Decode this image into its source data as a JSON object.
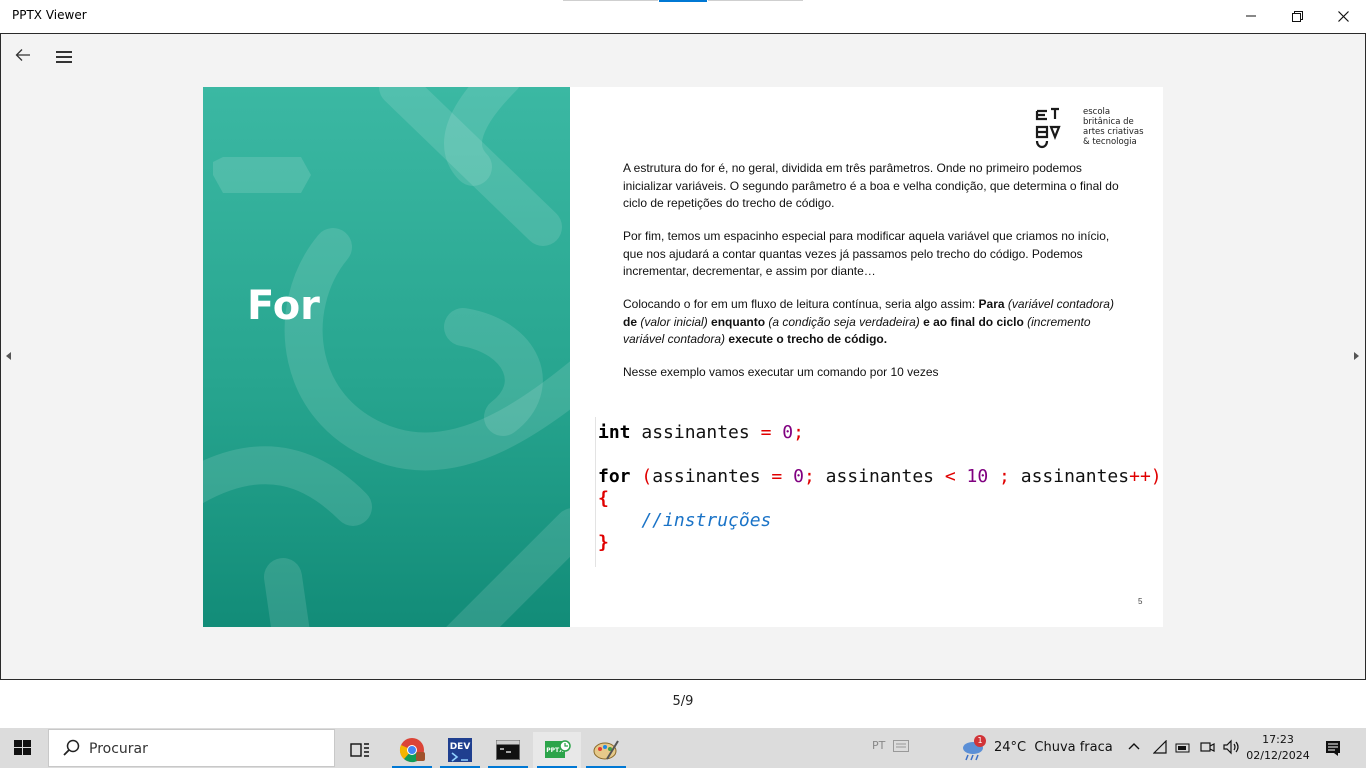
{
  "window": {
    "title": "PPTX Viewer",
    "minimize_icon": "minimize-icon",
    "restore_icon": "restore-icon",
    "close_icon": "close-icon"
  },
  "toolbar": {
    "back_icon": "arrow-left-icon",
    "menu_icon": "hamburger-menu-icon"
  },
  "slide": {
    "title": "For",
    "logo_text": [
      "escola",
      "britânica de",
      "artes criativas",
      "& tecnologia"
    ],
    "paragraph1": "A estrutura do for é, no geral, dividida em três parâmetros. Onde no primeiro podemos inicializar variáveis. O segundo parâmetro é a boa e velha condição, que determina o final do ciclo de repetições do trecho de código.",
    "paragraph2": "Por fim, temos um espacinho especial para modificar aquela variável que criamos no início, que nos ajudará a contar quantas vezes já passamos pelo trecho do código. Podemos incrementar, decrementar, e assim por diante…",
    "paragraph3": {
      "intro": "Colocando o for em um fluxo de leitura contínua, seria algo assim:  ",
      "para": "Para",
      "p1": " (variável contadora)",
      "de": "de",
      "p2": " (valor inicial) ",
      "enquanto": "enquanto",
      "p3": " (a condição seja verdadeira) ",
      "final": "e ao final do ciclo",
      "p4": " (incremento variável contadora) ",
      "execute": "execute o trecho de código."
    },
    "paragraph4": "Nesse exemplo vamos executar um comando por 10 vezes",
    "code": {
      "l1_kw": "int",
      "l1_id": " assinantes ",
      "l1_op": "=",
      "l1_num": " 0",
      "l1_end": ";",
      "l2_kw": "for",
      "l2_p1": " (",
      "l2_id1": "assinantes ",
      "l2_op1": "=",
      "l2_num1": " 0",
      "l2_semi1": ";",
      "l2_id2": " assinantes ",
      "l2_op2": "<",
      "l2_num2": " 10",
      "l2_semi2": " ;",
      "l2_id3": " assinantes",
      "l2_op3": "++",
      "l2_p2": ")",
      "l3": "{",
      "l4": "    //instruções",
      "l5": "}"
    },
    "page_number": "5"
  },
  "navigation": {
    "prev_icon": "chevron-left-icon",
    "next_icon": "chevron-right-icon",
    "counter": "5/9"
  },
  "taskbar": {
    "search_placeholder": "Procurar",
    "language": "PT",
    "weather": "24°C  Chuva fraca",
    "weather_badge": "1",
    "time": "17:23",
    "date": "02/12/2024",
    "apps": [
      "task-view-icon",
      "chrome-icon",
      "dev-cpp-icon",
      "terminal-icon",
      "pptx-viewer-icon",
      "paint-icon"
    ],
    "pptx_label": "PPTX",
    "dev_label": "DEV"
  },
  "colors": {
    "slide_green": "#2aa58f",
    "accent": "#0078d4",
    "code_keyword": "#000000",
    "code_operator": "#e00000",
    "code_number": "#800080",
    "code_comment": "#1a73c7"
  }
}
